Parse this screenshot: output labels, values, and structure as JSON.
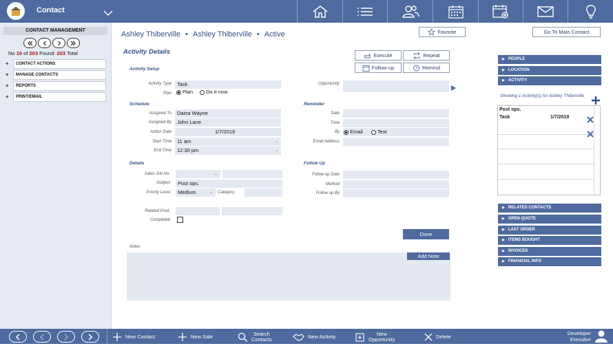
{
  "header": {
    "title": "Contact",
    "nav_icons": [
      "home-icon",
      "list-icon",
      "people-icon",
      "calendar-icon",
      "calendar-settings-icon",
      "mail-icon",
      "lightbulb-icon"
    ]
  },
  "left_panel": {
    "title": "CONTACT MANAGEMENT",
    "record_prefix": "No",
    "record_current": "10",
    "record_of": "of",
    "record_total": "203",
    "found_label": "Found:",
    "found_count": "203",
    "total_label": "Total",
    "items": [
      {
        "label": "CONTACT ACTIONS"
      },
      {
        "label": "MANAGE CONTACTS"
      },
      {
        "label": "REPORTS"
      },
      {
        "label": "PRINT/EMAIL"
      }
    ]
  },
  "breadcrumb": {
    "part1": "Ashley Thiberville",
    "part2": "Ashley Thiberville",
    "part3": "Active",
    "separator": "•"
  },
  "buttons": {
    "favorite": "Favorite",
    "go_main": "Go To Main Contact",
    "execute": "Execute",
    "repeat": "Repeat",
    "follow_up": "Follow-up",
    "remind": "Remind",
    "done": "Done",
    "add_note": "Add Note"
  },
  "activity": {
    "title": "Activity Details",
    "setup": {
      "title": "Activity Setup",
      "type_label": "Activity Type",
      "type_value": "Task",
      "plan_label": "Plan",
      "plan_opt1": "Plan",
      "plan_opt2": "Do it now",
      "opportunity_label": "Opportunity",
      "opportunity_value": ""
    },
    "schedule": {
      "title": "Schedule",
      "assigned_to_label": "Assigned To",
      "assigned_to_value": "Daina Wayne",
      "assigned_by_label": "Assigned By",
      "assigned_by_value": "John Lane",
      "action_date_label": "Action Date",
      "action_date_value": "1/7/2019",
      "start_time_label": "Start Time",
      "start_time_value": "11 am",
      "end_time_label": "End Time",
      "end_time_value": "12:30 pm"
    },
    "reminder": {
      "title": "Reminder",
      "date_label": "Date",
      "time_label": "Time",
      "by_label": "By",
      "by_opt1": "Email",
      "by_opt2": "Text",
      "email_label": "Email Address"
    },
    "details": {
      "title": "Details",
      "sales_job_label": "Sales Job No.",
      "subject_label": "Subject",
      "subject_value": "Post ops.",
      "priority_label": "Priority Level",
      "priority_value": "Medium",
      "category_label": "Category",
      "related_prod_label": "Related Prod.",
      "completed_label": "Completed"
    },
    "follow_up": {
      "title": "Follow Up",
      "date_label": "Follow up Date",
      "method_label": "Method",
      "by_label": "Follow up By"
    },
    "notes_label": "Notes"
  },
  "right_panel": {
    "top_items": [
      {
        "label": "PEOPLE"
      },
      {
        "label": "LOCATION"
      },
      {
        "label": "ACTIVITY"
      }
    ],
    "activity_caption": "Showing 1 Activity(s) for Ashley Thiberville",
    "activity_rows": [
      {
        "subject": "Post ops.",
        "type": "Task",
        "date": "1/7/2019"
      }
    ],
    "bottom_items": [
      {
        "label": "RELATED CONTACTS"
      },
      {
        "label": "OPEN QUOTE"
      },
      {
        "label": "LAST ORDER"
      },
      {
        "label": "ITEMS BOUGHT"
      },
      {
        "label": "INVOICES"
      },
      {
        "label": "FINANCIAL INFO"
      }
    ]
  },
  "bottom_bar": {
    "new_contact": "New Contact",
    "new_sale": "New Sale",
    "search_line1": "Search",
    "search_line2": "Contacts",
    "new_activity": "New Activity",
    "new_opp_line1": "New",
    "new_opp_line2": "Opportunity",
    "delete": "Delete",
    "user_name": "Developer",
    "user_role": "Executive"
  },
  "colors": {
    "primary": "#4e6a9e",
    "field_bg": "#e4e9f1",
    "panel_bg": "#e6ebf3",
    "accent_text": "#34508a",
    "record_number": "#a11111"
  }
}
